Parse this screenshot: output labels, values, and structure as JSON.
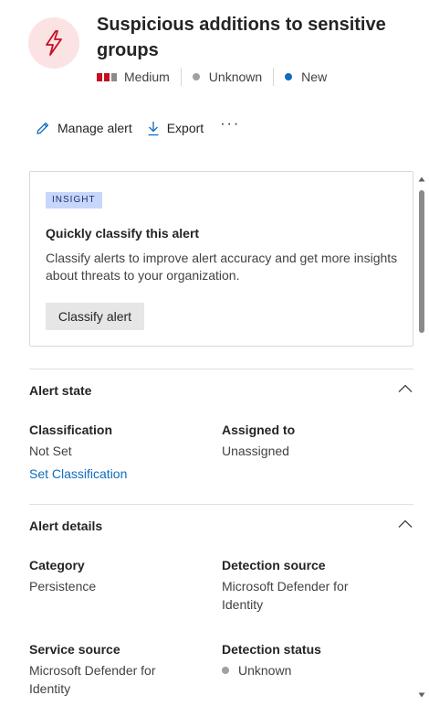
{
  "alert": {
    "title": "Suspicious additions to sensitive groups",
    "icon": "lightning-bolt-icon",
    "severity": "Medium",
    "status_detection": "Unknown",
    "status": "New",
    "colors": {
      "severity_active": "#c50f1f",
      "severity_inactive": "#8a8a8a",
      "unknown_dot": "#a0a0a0",
      "new_dot": "#0f6cbd",
      "icon_bg": "#fbe3e3"
    }
  },
  "toolbar": {
    "manage_label": "Manage alert",
    "export_label": "Export",
    "more_label": "···"
  },
  "insight": {
    "tag": "INSIGHT",
    "heading": "Quickly classify this alert",
    "text": "Classify alerts to improve alert accuracy and get more insights about threats to your organization.",
    "button": "Classify alert"
  },
  "alert_state": {
    "title": "Alert state",
    "classification_label": "Classification",
    "classification_value": "Not Set",
    "set_link": "Set Classification",
    "assigned_label": "Assigned to",
    "assigned_value": "Unassigned"
  },
  "alert_details": {
    "title": "Alert details",
    "category_label": "Category",
    "category_value": "Persistence",
    "detection_source_label": "Detection source",
    "detection_source_value": "Microsoft Defender for Identity",
    "service_source_label": "Service source",
    "service_source_value": "Microsoft Defender for Identity",
    "detection_status_label": "Detection status",
    "detection_status_value": "Unknown"
  }
}
